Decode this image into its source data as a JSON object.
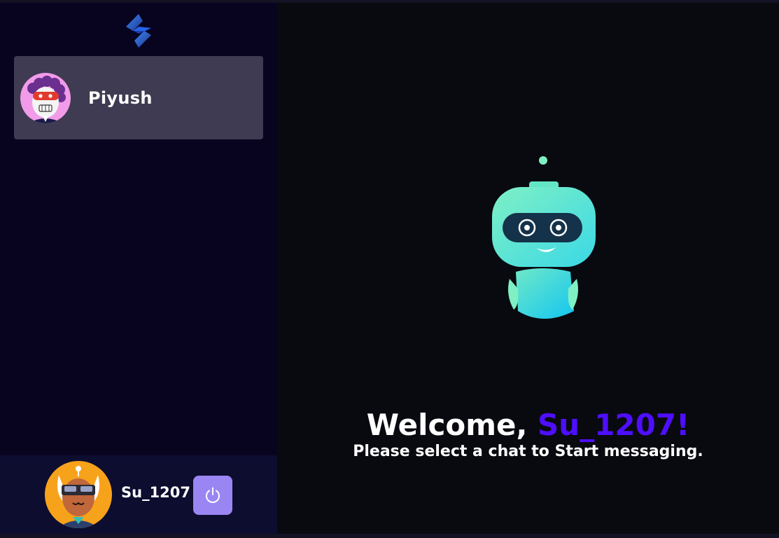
{
  "sidebar": {
    "logo_icon": "snappy-logo-icon",
    "contacts": [
      {
        "name": "Piyush",
        "avatar": "avatar-robot-red-mask-icon"
      }
    ]
  },
  "current_user": {
    "username": "Su_1207",
    "avatar": "avatar-sunglasses-orange-icon",
    "logout_icon": "power-icon"
  },
  "welcome": {
    "greeting": "Welcome, ",
    "username": "Su_1207",
    "exclaim": "!",
    "subtitle": "Please select a chat to Start messaging.",
    "image_icon": "robot-illustration-icon"
  },
  "colors": {
    "sidebar_bg": "#080420",
    "selected_contact_bg": "#3f3b52",
    "accent": "#4e0eff",
    "logout_bg": "#9a86f3",
    "main_bg": "#090a10"
  }
}
